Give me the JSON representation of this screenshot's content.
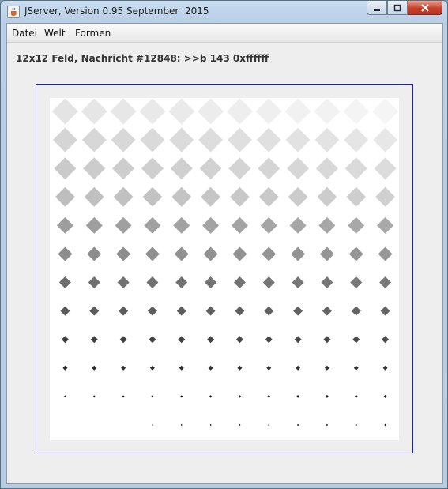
{
  "window": {
    "title": "JServer, Version 0.95 September  2015",
    "icon": "java-cup-icon",
    "controls": [
      "minimize-icon",
      "maximize-icon",
      "close-icon"
    ]
  },
  "menu": {
    "items": [
      {
        "label": "Datei"
      },
      {
        "label": "Welt"
      },
      {
        "label": "Formen"
      }
    ]
  },
  "status": {
    "text": "12x12 Feld, Nachricht #12848: >>b 143 0xffffff"
  },
  "board": {
    "rows": 12,
    "cols": 12,
    "shape": "diamond",
    "frame_color": "#1c1ccc",
    "background": "#ffffff"
  }
}
